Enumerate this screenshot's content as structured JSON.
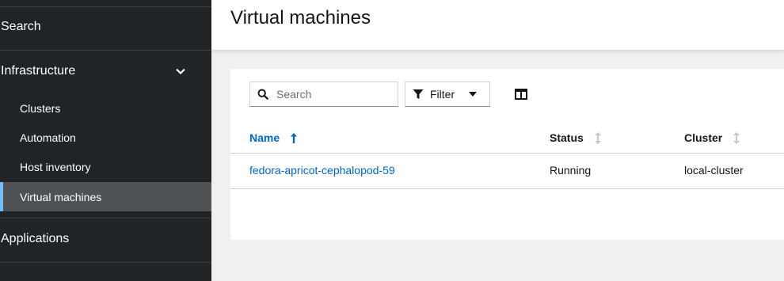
{
  "sidebar": {
    "search_label": "Search",
    "infrastructure_label": "Infrastructure",
    "items": [
      {
        "label": "Clusters"
      },
      {
        "label": "Automation"
      },
      {
        "label": "Host inventory"
      },
      {
        "label": "Virtual machines",
        "active": true
      }
    ],
    "applications_label": "Applications"
  },
  "page": {
    "title": "Virtual machines"
  },
  "toolbar": {
    "search_placeholder": "Search",
    "filter_label": "Filter"
  },
  "table": {
    "columns": [
      "Name",
      "Status",
      "Cluster"
    ],
    "rows": [
      {
        "name": "fedora-apricot-cephalopod-59",
        "status": "Running",
        "cluster": "local-cluster"
      }
    ]
  },
  "colors": {
    "sidebar_bg": "#212427",
    "active_bg": "#4f5255",
    "active_accent": "#73bcf7",
    "link": "#0066cc"
  }
}
